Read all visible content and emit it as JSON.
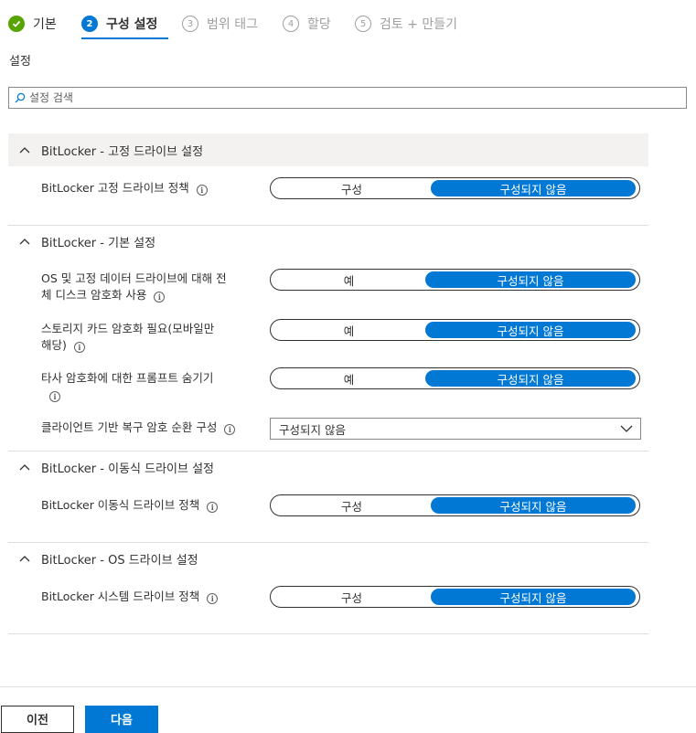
{
  "steps": [
    {
      "label": "기본",
      "state": "done",
      "icon": "checkmark-icon"
    },
    {
      "label": "구성 설정",
      "state": "active",
      "number": "2"
    },
    {
      "label": "범위 태그",
      "state": "todo",
      "number": "3"
    },
    {
      "label": "할당",
      "state": "todo",
      "number": "4"
    },
    {
      "label": "검토 + 만들기",
      "state": "todo",
      "number": "5"
    }
  ],
  "section_title": "설정",
  "search": {
    "placeholder": "설정 검색",
    "value": ""
  },
  "groups": [
    {
      "title": "BitLocker - 고정 드라이브 설정",
      "settings": [
        {
          "label": "BitLocker 고정 드라이브 정책",
          "options": [
            "구성",
            "구성되지 않음"
          ],
          "selected": "구성되지 않음"
        }
      ]
    },
    {
      "title": "BitLocker - 기본 설정",
      "settings": [
        {
          "label_line1": "OS 및 고정 데이터 드라이브에 대해 전",
          "label_line2": "체 디스크 암호화 사용",
          "options": [
            "예",
            "구성되지 않음"
          ],
          "selected": "구성되지 않음"
        },
        {
          "label_line1": "스토리지 카드 암호화 필요(모바일만",
          "label_line2": "해당)",
          "options": [
            "예",
            "구성되지 않음"
          ],
          "selected": "구성되지 않음"
        },
        {
          "label_line1": "타사 암호화에 대한 프롬프트 숨기기",
          "label_line2": "",
          "options": [
            "예",
            "구성되지 않음"
          ],
          "selected": "구성되지 않음"
        },
        {
          "label": "클라이언트 기반 복구 암호 순환 구성",
          "dropdown_value": "구성되지 않음"
        }
      ]
    },
    {
      "title": "BitLocker - 이동식 드라이브 설정",
      "settings": [
        {
          "label": "BitLocker 이동식 드라이브 정책",
          "options": [
            "구성",
            "구성되지 않음"
          ],
          "selected": "구성되지 않음"
        }
      ]
    },
    {
      "title": "BitLocker - OS 드라이브 설정",
      "settings": [
        {
          "label": "BitLocker 시스템 드라이브 정책",
          "options": [
            "구성",
            "구성되지 않음"
          ],
          "selected": "구성되지 않음"
        }
      ]
    }
  ],
  "footer": {
    "prev_label": "이전",
    "next_label": "다음"
  },
  "colors": {
    "accent": "#0078d4",
    "success": "#57a300",
    "text": "#323130",
    "muted": "#a19f9d",
    "header_bg": "#f3f2f1"
  }
}
